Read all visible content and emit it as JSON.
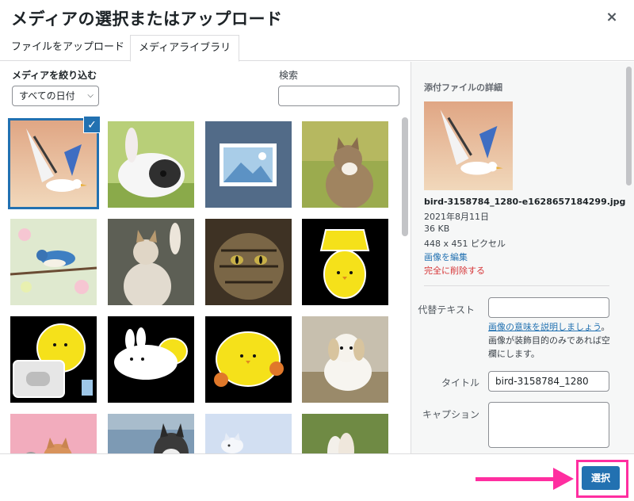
{
  "modal": {
    "title": "メディアの選択またはアップロード",
    "close_label": "×"
  },
  "tabs": [
    {
      "label": "ファイルをアップロード",
      "active": false
    },
    {
      "label": "メディアライブラリ",
      "active": true
    }
  ],
  "toolbar": {
    "filter_label": "メディアを絞り込む",
    "filter_value": "すべての日付",
    "search_label": "検索",
    "search_value": ""
  },
  "grid": {
    "items": [
      {
        "name": "bird-gull",
        "selected": true,
        "colors": [
          "#e9c8a6",
          "#b98c6b"
        ]
      },
      {
        "name": "rabbit",
        "selected": false,
        "colors": [
          "#a8c86a",
          "#fafafa"
        ]
      },
      {
        "name": "placeholder-image",
        "selected": false,
        "colors": [
          "#50698a",
          "#9fc3df"
        ]
      },
      {
        "name": "cat-kitten",
        "selected": false,
        "colors": [
          "#93a94a",
          "#8a7050"
        ]
      },
      {
        "name": "bluebird-blossom",
        "selected": false,
        "colors": [
          "#d8e6c9",
          "#4f87c4"
        ]
      },
      {
        "name": "cat-paw",
        "selected": false,
        "colors": [
          "#5a5b52",
          "#d4cdbf"
        ]
      },
      {
        "name": "tabby-cat",
        "selected": false,
        "colors": [
          "#4a3c2c",
          "#8c7a5c"
        ]
      },
      {
        "name": "chick-lamp",
        "selected": false,
        "colors": [
          "#000000",
          "#f5e11a"
        ]
      },
      {
        "name": "chick-laptop",
        "selected": false,
        "colors": [
          "#000000",
          "#f5e11a"
        ]
      },
      {
        "name": "chick-bunny",
        "selected": false,
        "colors": [
          "#000000",
          "#ffffff"
        ]
      },
      {
        "name": "chick-flowers",
        "selected": false,
        "colors": [
          "#000000",
          "#f5e11a"
        ]
      },
      {
        "name": "puppy",
        "selected": false,
        "colors": [
          "#b8ae9c",
          "#f4f2ee"
        ]
      },
      {
        "name": "dog-pink",
        "selected": false,
        "colors": [
          "#f0a6b8",
          "#d89060"
        ]
      },
      {
        "name": "husky",
        "selected": false,
        "colors": [
          "#6c8ca8",
          "#3a3a3a"
        ]
      },
      {
        "name": "arctic-fox",
        "selected": false,
        "colors": [
          "#c8d8f0",
          "#f4f6fa"
        ]
      },
      {
        "name": "bunny-grass",
        "selected": false,
        "colors": [
          "#5f7d38",
          "#b89a7a"
        ]
      }
    ]
  },
  "details": {
    "title": "添付ファイルの詳細",
    "filename": "bird-3158784_1280-e1628657184299.jpg",
    "date": "2021年8月11日",
    "size": "36 KB",
    "dimensions": "448 x 451 ピクセル",
    "edit_link": "画像を編集",
    "delete_link": "完全に削除する",
    "alt_label": "代替テキスト",
    "alt_value": "",
    "alt_help_link": "画像の意味を説明しましょう",
    "alt_help_text": "。画像が装飾目的のみであれば空欄にします。",
    "title_label": "タイトル",
    "title_value": "bird-3158784_1280",
    "caption_label": "キャプション",
    "caption_value": ""
  },
  "footer": {
    "select_label": "選択"
  },
  "annotation": {
    "color": "#ff2ea0"
  }
}
